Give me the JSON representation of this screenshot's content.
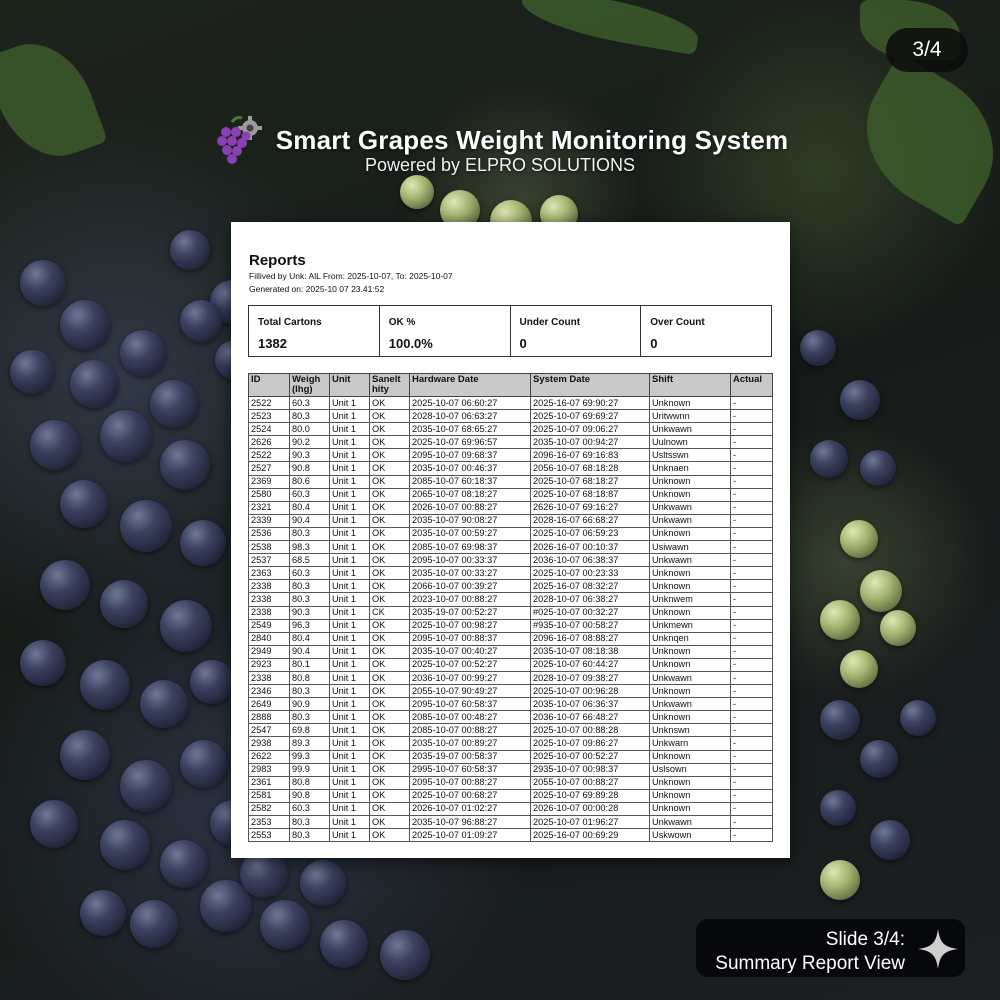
{
  "slide_counter": "3/4",
  "header": {
    "title": "Smart Grapes Weight Monitoring System",
    "subtitle": "Powered by ELPRO SOLUTIONS",
    "icon": "grapes-gear-icon"
  },
  "report": {
    "title": "Reports",
    "filter_text": "Fillived by Unk: AlL From: 2025-10-07, To: 2025-10-07",
    "generated_text": "Generated on: 2025-10 07 23.41:52",
    "summary": [
      {
        "label": "Total Cartons",
        "value": "1382"
      },
      {
        "label": "OK %",
        "value": "100.0%"
      },
      {
        "label": "Under Count",
        "value": "0"
      },
      {
        "label": "Over Count",
        "value": "0"
      }
    ],
    "columns": [
      "ID",
      "Weigh (Ihg)",
      "Unit",
      "Sanelt hity",
      "Hardware Date",
      "System Date",
      "Shift",
      "Actual"
    ],
    "rows": [
      [
        "2522",
        "60.3",
        "Unit 1",
        "OK",
        "2025-10-07 06:60:27",
        "2025-16-07 69:90:27",
        "Unknown",
        "-"
      ],
      [
        "2523",
        "80.3",
        "Unit 1",
        "OK",
        "2028-10-07 06:63:27",
        "2025-10-07 69:69:27",
        "Uritwwnn",
        "-"
      ],
      [
        "2524",
        "80.0",
        "Unit 1",
        "OK",
        "2035-10-07 68:65:27",
        "2025-10-07 09:06:27",
        "Unkwawn",
        "-"
      ],
      [
        "2626",
        "90.2",
        "Unit 1",
        "OK",
        "2025-10-07 69:96:57",
        "2035-10-07 00:94:27",
        "Uulnown",
        "-"
      ],
      [
        "2522",
        "90.3",
        "Unit 1",
        "OK",
        "2095-10-07 09:68:37",
        "2096-16-07 69:16:83",
        "Usltsswn",
        "-"
      ],
      [
        "2527",
        "90.8",
        "Unit 1",
        "OK",
        "2035-10-07 00:46:37",
        "2056-10-07 68:18:28",
        "Unknaen",
        "-"
      ],
      [
        "2369",
        "80.6",
        "Unit 1",
        "OK",
        "2085-10-07 60:18:37",
        "2025-10-07 68:18:27",
        "Unknown",
        "-"
      ],
      [
        "2580",
        "60.3",
        "Unit 1",
        "OK",
        "2065-10-07 08:18:27",
        "2025-10-07 68:18:87",
        "Unknown",
        "-"
      ],
      [
        "2321",
        "80.4",
        "Unit 1",
        "OK",
        "2026-10-07 00:88:27",
        "2626-10-07 69:16:27",
        "Unkwawn",
        "-"
      ],
      [
        "2339",
        "90.4",
        "Unit 1",
        "OK",
        "2035-10-07 90:08:27",
        "2028-16-07 66:68:27",
        "Unkwawn",
        "-"
      ],
      [
        "2536",
        "80.3",
        "Unit 1",
        "OK",
        "2035-10-07 00:59:27",
        "2025-10-07 06:59:23",
        "Unknown",
        "-"
      ],
      [
        "2538",
        "98.3",
        "Unit 1",
        "OK",
        "2085-10-07 69:98:37",
        "2026-16-07 00:10:37",
        "Usiwawn",
        "-"
      ],
      [
        "2537",
        "68.5",
        "Unit 1",
        "OK",
        "2095-10-07 00:33:37",
        "2036-10-07 06:38:37",
        "Unkwawn",
        "-"
      ],
      [
        "2363",
        "60.3",
        "Unit 1",
        "OK",
        "2035-10-07 00:33:27",
        "2025-10-07 00:23:33",
        "Unknown",
        "-"
      ],
      [
        "2338",
        "80.3",
        "Unit 1",
        "OK",
        "2066-10-07 00:39:27",
        "2025-16-07 08:32:27",
        "Unknown",
        "-"
      ],
      [
        "2338",
        "80.3",
        "Unit 1",
        "OK",
        "2023-10-07 00:88:27",
        "2028-10-07 06:38:27",
        "Unknwem",
        "-"
      ],
      [
        "2338",
        "90.3",
        "Unit 1",
        "CK",
        "2035-19-07 00:52:27",
        "#025-10-07 00:32:27",
        "Unknown",
        "-"
      ],
      [
        "2549",
        "96.3",
        "Unit 1",
        "OK",
        "2025-10-07 00:98:27",
        "#935-10-07 00:58:27",
        "Unkmewn",
        "-"
      ],
      [
        "2840",
        "80.4",
        "Unit 1",
        "OK",
        "2095-10-07 00:88:37",
        "2096-16-07 08:88:27",
        "Unknqen",
        "-"
      ],
      [
        "2949",
        "90.4",
        "Unit 1",
        "OK",
        "2035-10-07 00:40:27",
        "2035-10-07 08:18:38",
        "Unknown",
        "-"
      ],
      [
        "2923",
        "80.1",
        "Unit 1",
        "OK",
        "2025-10-07 00:52:27",
        "2025-10-07 60:44:27",
        "Unknown",
        "-"
      ],
      [
        "2338",
        "80.8",
        "Unit 1",
        "OK",
        "2036-10-07 00:99:27",
        "2028-10-07 09:38:27",
        "Unkwawn",
        "-"
      ],
      [
        "2346",
        "80.3",
        "Unit 1",
        "OK",
        "2055-10-07 90:49:27",
        "2025-10-07 00:96:28",
        "Unknown",
        "-"
      ],
      [
        "2649",
        "90.9",
        "Unit 1",
        "OK",
        "2095-10-07 60:58:37",
        "2035-10-07 06:36:37",
        "Unkwawn",
        "-"
      ],
      [
        "2888",
        "80.3",
        "Unit 1",
        "OK",
        "2085-10-07 00:48:27",
        "2036-10-07 66:48:27",
        "Unknown",
        "-"
      ],
      [
        "2547",
        "69.8",
        "Unit 1",
        "OK",
        "2085-10-07 00:88:27",
        "2025-10-07 00:88:28",
        "Unknswn",
        "-"
      ],
      [
        "2938",
        "89.3",
        "Unit 1",
        "OK",
        "2035-10-07 00:89:27",
        "2025-10-07 09:86:27",
        "Unkwarn",
        "-"
      ],
      [
        "2622",
        "99.3",
        "Unit 1",
        "OK",
        "2035-19-07 00:58:37",
        "2025-10-07 00:52:27",
        "Unknown",
        "-"
      ],
      [
        "2983",
        "99.9",
        "Unit 1",
        "OK",
        "2995-10-07 60:58:37",
        "2935-10-07 00:98:37",
        "Uslsown",
        "-"
      ],
      [
        "2361",
        "80.8",
        "Unit 1",
        "OK",
        "2095-10-07 00:88:27",
        "2055-10-07 00:88:27",
        "Unknown",
        "-"
      ],
      [
        "2581",
        "90.8",
        "Unit 1",
        "OK",
        "2025-10-07 00:68:27",
        "2025-10-07 69:89:28",
        "Unknown",
        "-"
      ],
      [
        "2582",
        "60.3",
        "Unit 1",
        "OK",
        "2026-10-07 01:02:27",
        "2026-10-07 00:00:28",
        "Unknown",
        "-"
      ],
      [
        "2353",
        "80.3",
        "Unit 1",
        "OK",
        "2035-10-07 96:88:27",
        "2025-10-07 01:96:27",
        "Unkwawn",
        "-"
      ],
      [
        "2553",
        "80.3",
        "Unit 1",
        "OK",
        "2025-10-07 01:09:27",
        "2025-16-07 00:69:29",
        "Uskwown",
        "-"
      ]
    ]
  },
  "caption": {
    "line1": "Slide 3/4:",
    "line2": "Summary Report View",
    "icon": "sparkle-icon"
  }
}
